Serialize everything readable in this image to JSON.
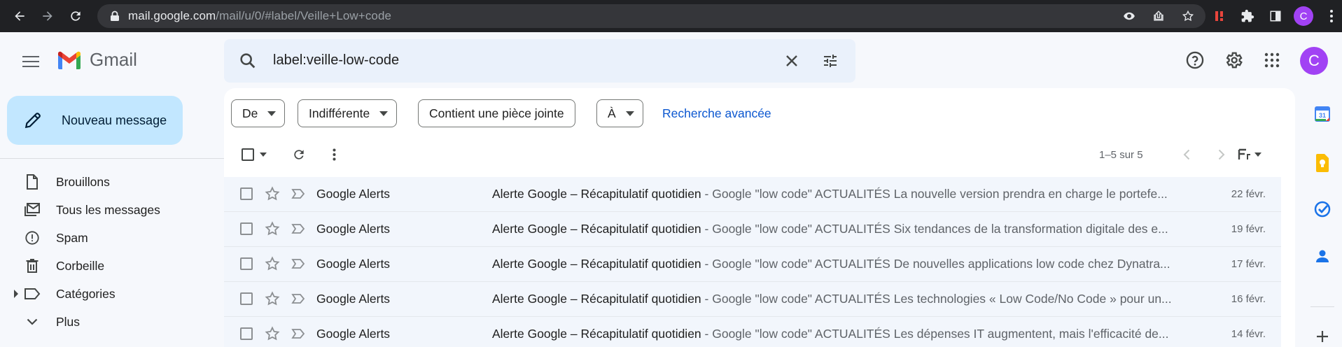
{
  "browser": {
    "url_host": "mail.google.com",
    "url_path": "/mail/u/0/#label/Veille+Low+code",
    "profile_initial": "C"
  },
  "app": {
    "name": "Gmail"
  },
  "search": {
    "query": "label:veille-low-code"
  },
  "account": {
    "initial": "C",
    "color": "#a142f4"
  },
  "compose": {
    "label": "Nouveau message"
  },
  "sidebar": {
    "items": [
      {
        "label": "Brouillons",
        "icon": "draft-icon"
      },
      {
        "label": "Tous les messages",
        "icon": "all-mail-icon"
      },
      {
        "label": "Spam",
        "icon": "spam-icon"
      },
      {
        "label": "Corbeille",
        "icon": "trash-icon"
      },
      {
        "label": "Catégories",
        "icon": "label-icon"
      },
      {
        "label": "Plus",
        "icon": "expand-more-icon"
      }
    ]
  },
  "filters": {
    "from": "De",
    "any_time": "Indifférente",
    "has_attachment": "Contient une pièce jointe",
    "to": "À",
    "advanced": "Recherche avancée"
  },
  "pager": {
    "text": "1–5 sur 5"
  },
  "emails": [
    {
      "sender": "Google Alerts",
      "subject": "Alerte Google – Récapitulatif quotidien",
      "snippet": " - Google \"low code\" ACTUALITÉS La nouvelle version prendra en charge le portefe...",
      "date": "22 févr."
    },
    {
      "sender": "Google Alerts",
      "subject": "Alerte Google – Récapitulatif quotidien",
      "snippet": " - Google \"low code\" ACTUALITÉS Six tendances de la transformation digitale des e...",
      "date": "19 févr."
    },
    {
      "sender": "Google Alerts",
      "subject": "Alerte Google – Récapitulatif quotidien",
      "snippet": " - Google \"low code\" ACTUALITÉS De nouvelles applications low code chez Dynatra...",
      "date": "17 févr."
    },
    {
      "sender": "Google Alerts",
      "subject": "Alerte Google – Récapitulatif quotidien",
      "snippet": " - Google \"low code\" ACTUALITÉS Les technologies « Low Code/No Code » pour un...",
      "date": "16 févr."
    },
    {
      "sender": "Google Alerts",
      "subject": "Alerte Google – Récapitulatif quotidien",
      "snippet": " - Google \"low code\" ACTUALITÉS Les dépenses IT augmentent, mais l'efficacité de...",
      "date": "14 févr."
    }
  ],
  "side_panel": {
    "apps": [
      "calendar-icon",
      "keep-icon",
      "tasks-icon",
      "contacts-icon",
      "add-icon"
    ]
  }
}
